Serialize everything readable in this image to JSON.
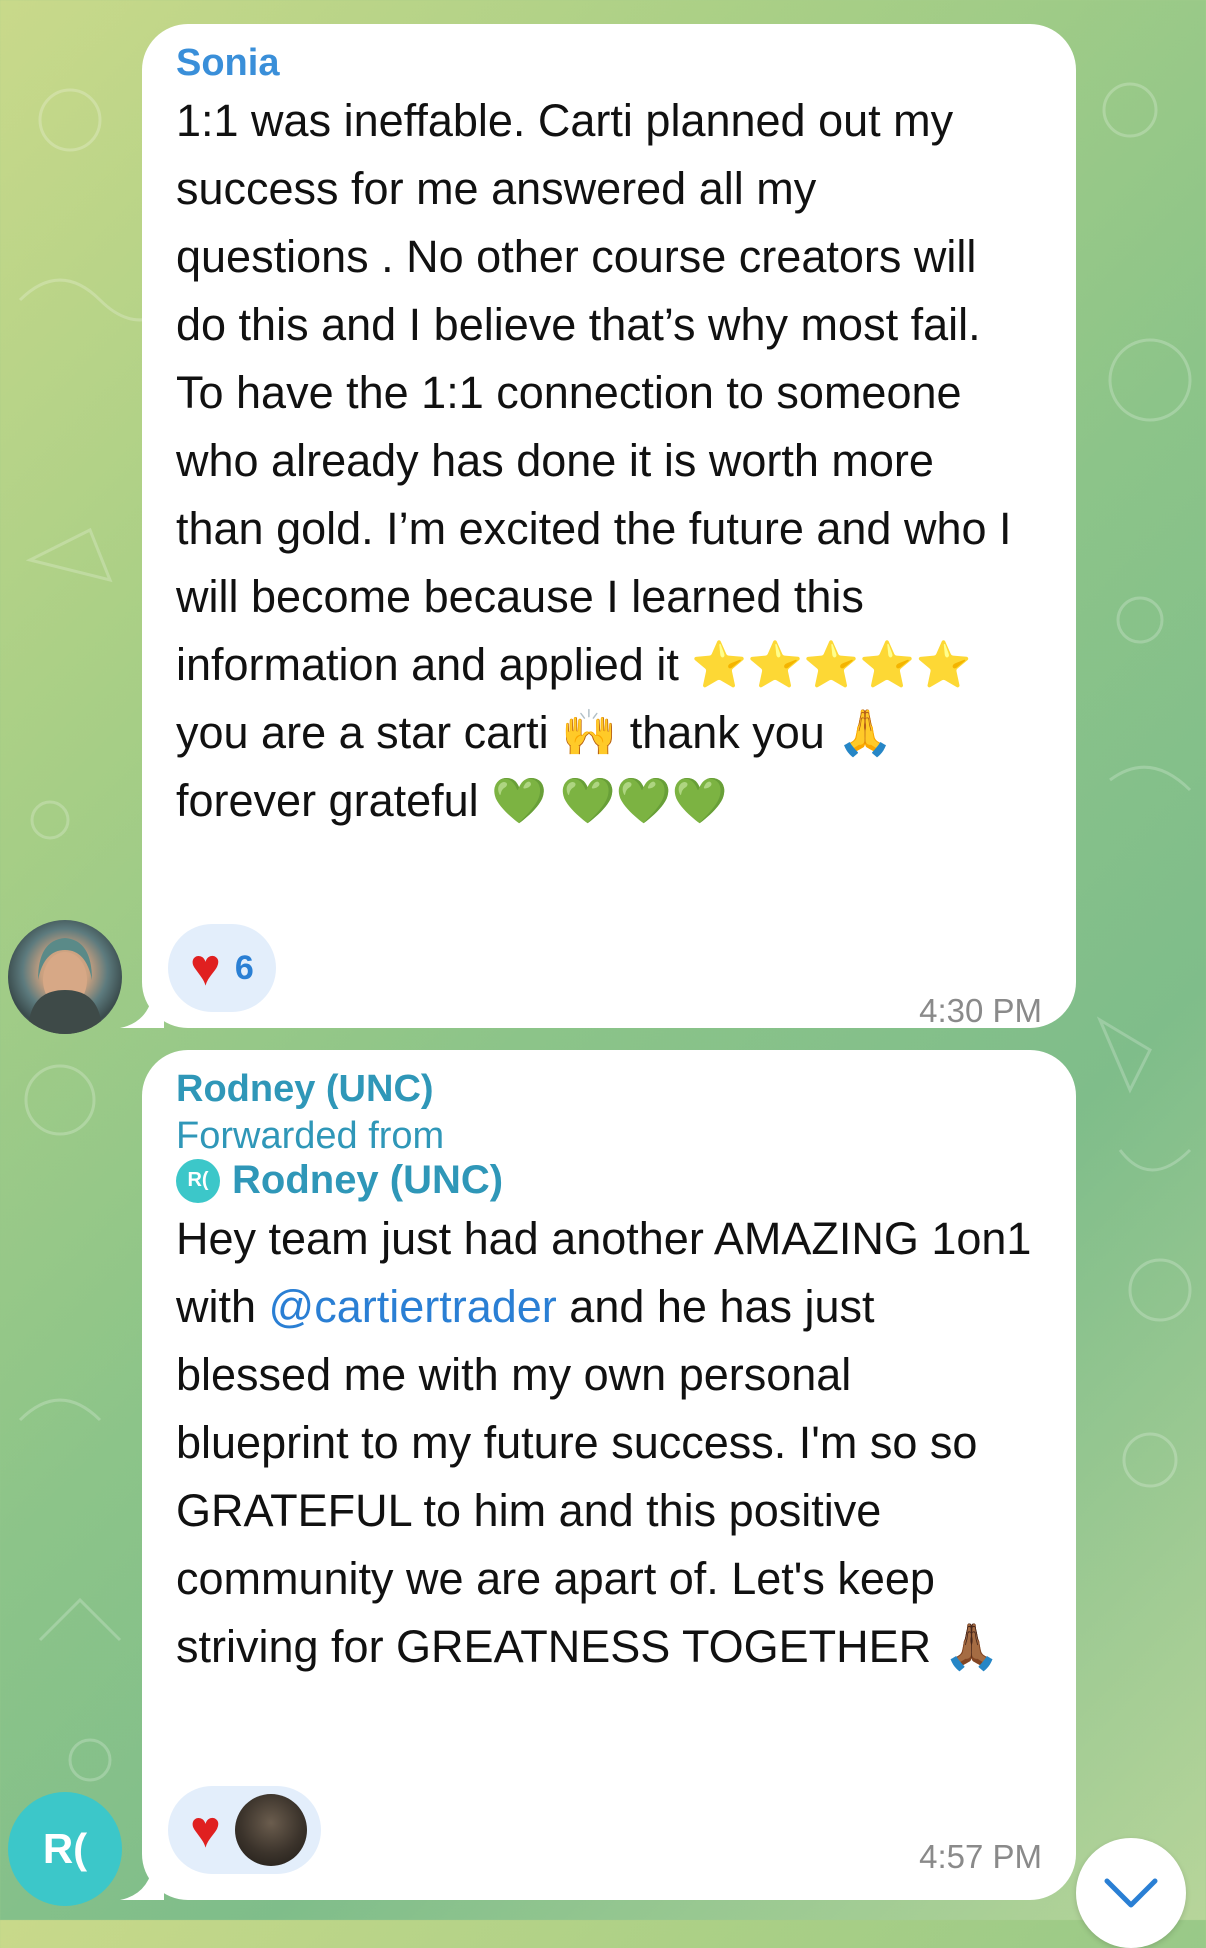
{
  "chat": {
    "messages": [
      {
        "sender": "Sonia",
        "text": "1:1 was ineffable. Carti planned out my success for me answered all my questions . No other course creators will do this and I believe that’s why most fail. To have the 1:1 connection to someone who already has done it is worth more than gold. I’m excited the future and who I will become because I learned this information and applied it ⭐⭐⭐⭐⭐ you are a star carti 🙌 thank you 🙏 forever grateful 💚 💚💚💚",
        "reaction": {
          "emoji": "♥",
          "count": "6"
        },
        "time": "4:30 PM",
        "avatar_icon": "user-photo"
      },
      {
        "sender": "Rodney (UNC)",
        "forwarded_label": "Forwarded from",
        "forwarded_from": "Rodney (UNC)",
        "forwarded_initials": "R(",
        "text_before_mention": "Hey team just had another AMAZING 1on1 with ",
        "mention": "@cartiertrader",
        "text_after_mention": " and he has just blessed me with my own personal blueprint to my future success. I'm so so GRATEFUL to him and this positive community we are apart of. Let's keep striving for GREATNESS TOGETHER 🙏🏾",
        "reaction": {
          "emoji": "♥"
        },
        "time": "4:57 PM",
        "avatar_initials": "R("
      }
    ]
  },
  "colors": {
    "sender_sonia": "#3a8fd9",
    "sender_rodney": "#2f97b8",
    "mention": "#2a7fd4",
    "reaction_bg": "#e3eefb",
    "heart": "#e02020",
    "avatar_initials_bg": "#3cc7c9"
  },
  "icons": {
    "scroll_down": "chevron-down-icon"
  }
}
